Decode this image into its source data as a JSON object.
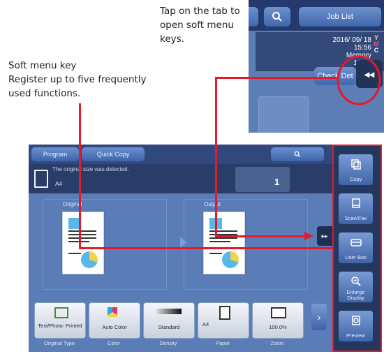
{
  "annotations": {
    "tab_tip": [
      "Tap on the tab to",
      "open soft menu",
      "keys."
    ],
    "soft_key_title": "Soft menu key",
    "soft_key_desc": [
      "Register up to five frequently",
      "used functions."
    ]
  },
  "inset": {
    "job_list_label": "Job List",
    "date": "2016/ 09/ 18",
    "time": "15:56",
    "memory_label": "Memory",
    "memory_value": "100%",
    "check_details_label": "Check Det",
    "tab_symbol": "◂◂"
  },
  "screen": {
    "program_label": "Program",
    "quick_copy_label": "Quick Copy",
    "message": "The original size was detected.",
    "original_size": "A4",
    "original_label": "Original",
    "output_label": "Output",
    "copies": "1",
    "function_buttons": [
      {
        "label": "Text/Photo: Printed",
        "caption": "Original Type"
      },
      {
        "label": "Auto Color",
        "caption": "Color"
      },
      {
        "label": "Standard",
        "caption": "Density"
      },
      {
        "label": "A4",
        "caption": "Paper"
      },
      {
        "label": "100.0%",
        "caption": "Zoom"
      }
    ],
    "more_symbol": "›",
    "tab_symbol": "▸▸"
  },
  "soft_keys": [
    {
      "label": "Copy",
      "icon": "copy-icon"
    },
    {
      "label": "Scan/Fax",
      "icon": "scan-fax-icon"
    },
    {
      "label": "User Box",
      "icon": "user-box-icon"
    },
    {
      "label": "Enlarge Display",
      "icon": "magnifier-icon"
    },
    {
      "label": "Preview",
      "icon": "preview-icon"
    }
  ],
  "colors": {
    "annotation_red": "#e4192a",
    "screen_blue": "#5b7db7",
    "header_dark": "#31487d"
  }
}
